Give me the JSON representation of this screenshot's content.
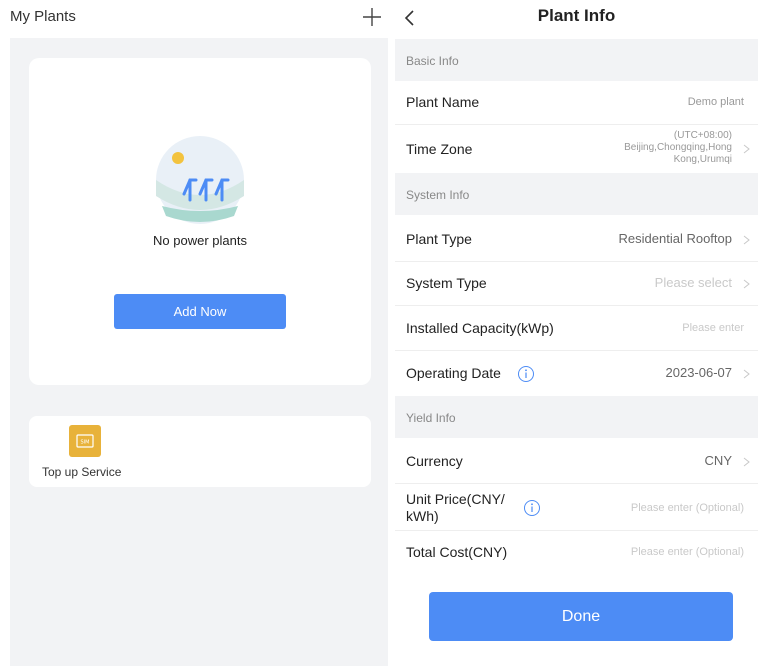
{
  "left": {
    "header_title": "My Plants",
    "empty_text": "No power plants",
    "add_button": "Add Now",
    "service_label": "Top up Service",
    "service_icon_text": "SIM"
  },
  "right": {
    "header_title": "Plant Info",
    "sections": {
      "basic": "Basic Info",
      "system": "System Info",
      "yield": "Yield Info"
    },
    "plant_name": {
      "label": "Plant Name",
      "value": "Demo plant"
    },
    "time_zone": {
      "label": "Time Zone",
      "value_line1": "(UTC+08:00)",
      "value_line2": "Beijing,Chongqing,Hong",
      "value_line3": "Kong,Urumqi"
    },
    "plant_type": {
      "label": "Plant Type",
      "value": "Residential Rooftop"
    },
    "system_type": {
      "label": "System Type",
      "placeholder": "Please select"
    },
    "installed_capacity": {
      "label": "Installed Capacity(kWp)",
      "placeholder": "Please enter"
    },
    "operating_date": {
      "label": "Operating Date",
      "value": "2023-06-07"
    },
    "currency": {
      "label": "Currency",
      "value": "CNY"
    },
    "unit_price": {
      "label_line1": "Unit Price(CNY/",
      "label_line2": "kWh)",
      "placeholder": "Please enter (Optional)"
    },
    "total_cost": {
      "label": "Total Cost(CNY)",
      "placeholder": "Please enter (Optional)"
    },
    "done_button": "Done"
  },
  "colors": {
    "accent": "#4d8cf5",
    "section_bg": "#f2f3f5",
    "sim_icon": "#e8b23a"
  }
}
